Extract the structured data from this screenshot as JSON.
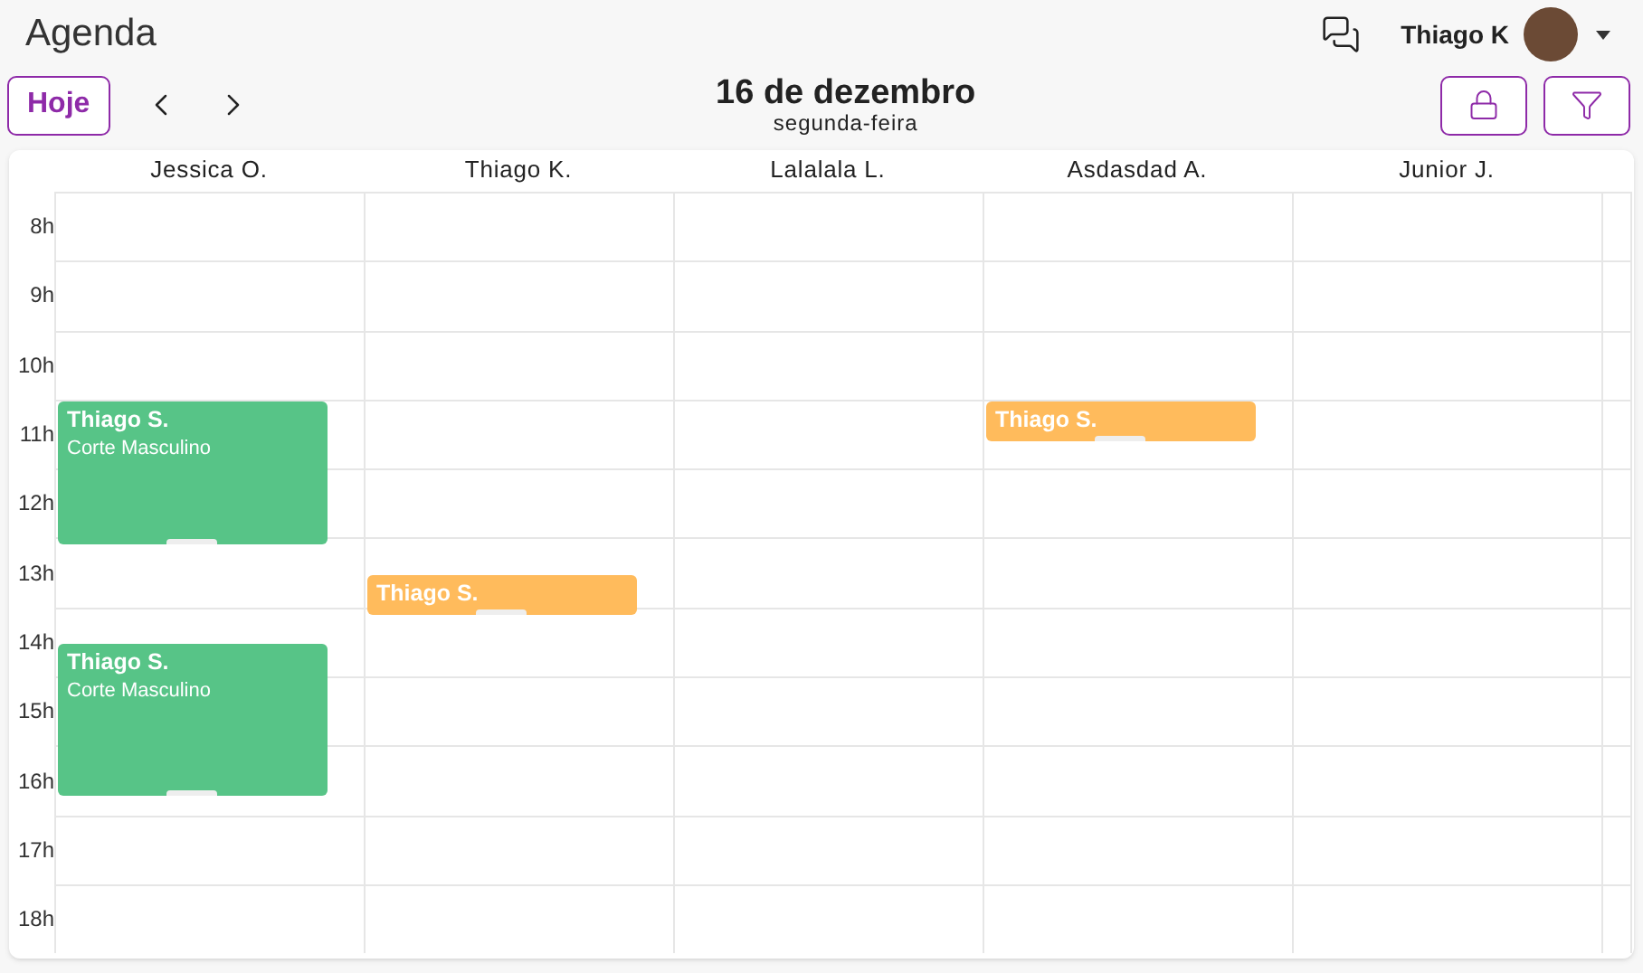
{
  "title": "Agenda",
  "user": {
    "name": "Thiago K"
  },
  "toolbar": {
    "today_button": "Hoje",
    "date": "16 de dezembro",
    "weekday": "segunda-feira"
  },
  "hours": [
    "8h",
    "9h",
    "10h",
    "11h",
    "12h",
    "13h",
    "14h",
    "15h",
    "16h",
    "17h",
    "18h"
  ],
  "resources": [
    {
      "name": "Jessica O.",
      "events": [
        {
          "client": "Thiago S.",
          "service": "Corte Masculino",
          "color": "#57c487"
        },
        {
          "client": "Thiago S.",
          "service": "Corte Masculino",
          "color": "#57c487"
        }
      ]
    },
    {
      "name": "Thiago K.",
      "events": [
        {
          "client": "Thiago S.",
          "color": "#ffbb5c"
        }
      ]
    },
    {
      "name": "Lalalala L."
    },
    {
      "name": "Asdasdad A.",
      "events": [
        {
          "client": "Thiago S.",
          "color": "#ffbb5c"
        }
      ]
    },
    {
      "name": "Junior J."
    }
  ]
}
